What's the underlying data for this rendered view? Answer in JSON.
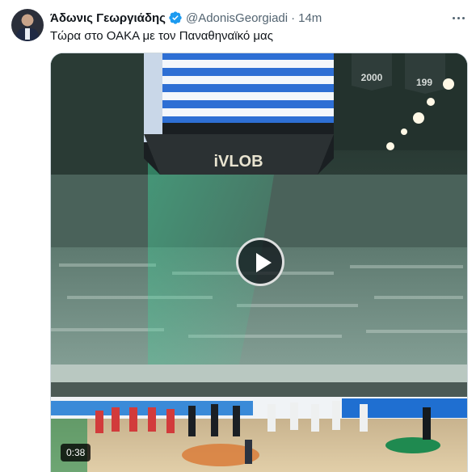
{
  "tweet": {
    "author_name": "Άδωνις Γεωργιάδης",
    "handle": "@AdonisGeorgiadi",
    "separator": "·",
    "time": "14m",
    "text": "Τώρα στο ΟΑΚΑ με τον Παναθηναϊκό μας",
    "verified_icon": "verified-badge-icon",
    "more_icon": "more-options-icon"
  },
  "media": {
    "type": "video",
    "duration": "0:38",
    "play_icon": "play-icon",
    "scoreboard_logo": "iVLOB",
    "banner_year_1": "2000",
    "banner_year_2": "199"
  },
  "colors": {
    "text": "#0f1419",
    "secondary": "#536471",
    "verified": "#1d9bf0",
    "video_overlay": "#000000"
  }
}
